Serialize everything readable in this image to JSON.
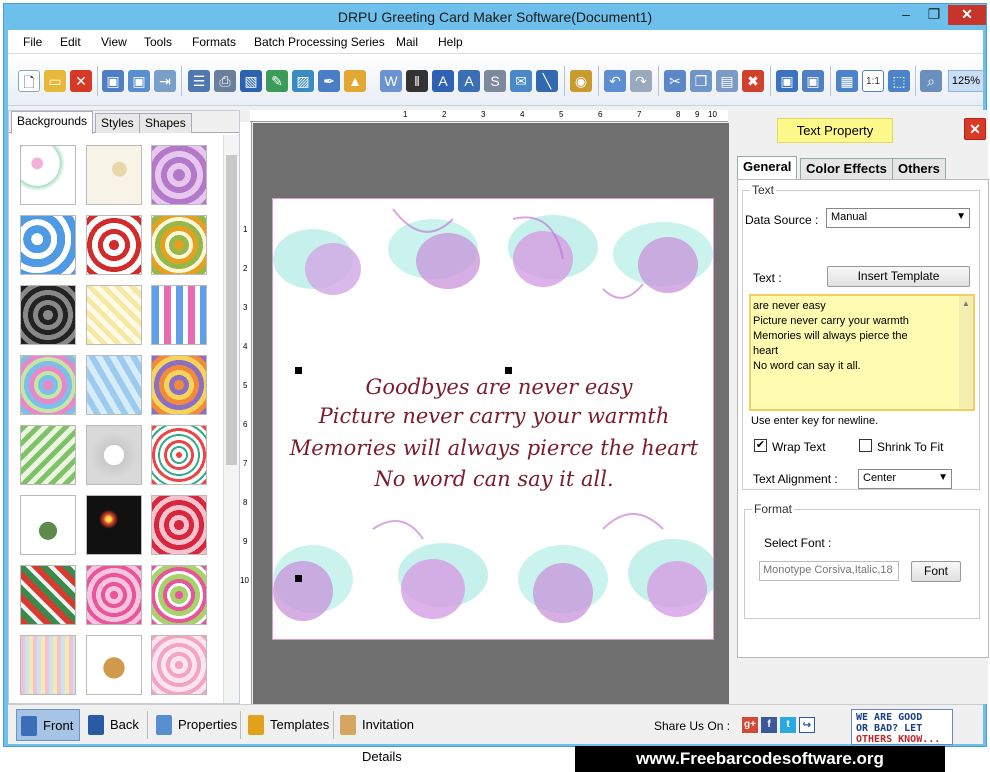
{
  "window": {
    "title": "DRPU Greeting Card Maker Software(Document1)"
  },
  "menu": [
    "File",
    "Edit",
    "View",
    "Tools",
    "Formats",
    "Batch Processing Series",
    "Mail",
    "Help"
  ],
  "toolbar": {
    "zoom": "125%",
    "one_to_one": "1:1"
  },
  "left_panel": {
    "tabs": [
      "Backgrounds",
      "Styles",
      "Shapes"
    ],
    "active_tab": "Backgrounds"
  },
  "ruler": {
    "top": [
      "1",
      "2",
      "3",
      "4",
      "5",
      "6",
      "7",
      "8",
      "9",
      "10"
    ],
    "left": [
      "1",
      "2",
      "3",
      "4",
      "5",
      "6",
      "7",
      "8",
      "9",
      "10"
    ]
  },
  "card": {
    "line1": "Goodbyes are never easy",
    "line2": "Picture never carry your warmth",
    "line3": "Memories will always pierce the heart",
    "line4": "No word can say it all."
  },
  "right_panel": {
    "header": "Text Property",
    "tabs": [
      "General",
      "Color Effects",
      "Others"
    ],
    "active_tab": "General",
    "text_group": "Text",
    "data_source_label": "Data Source :",
    "data_source_value": "Manual",
    "text_label": "Text :",
    "insert_template": "Insert Template",
    "text_lines": [
      "are never easy",
      "Picture never carry your warmth",
      "Memories will always pierce the",
      "heart",
      "No word can say it all."
    ],
    "hint": "Use enter key for newline.",
    "wrap_text": "Wrap Text",
    "wrap_text_checked": true,
    "shrink_to_fit": "Shrink To Fit",
    "shrink_checked": false,
    "alignment_label": "Text Alignment :",
    "alignment_value": "Center",
    "format_group": "Format",
    "select_font_label": "Select Font :",
    "font_value": "Monotype Corsiva,Italic,18",
    "font_button": "Font"
  },
  "bottom_bar": {
    "front": "Front",
    "back": "Back",
    "properties": "Properties",
    "templates": "Templates",
    "invitation": "Invitation Details",
    "share": "Share Us On :",
    "feedback": [
      "WE ARE GOOD",
      "OR BAD? LET",
      "OTHERS KNOW..."
    ]
  },
  "footer": "www.Freebarcodesoftware.org"
}
